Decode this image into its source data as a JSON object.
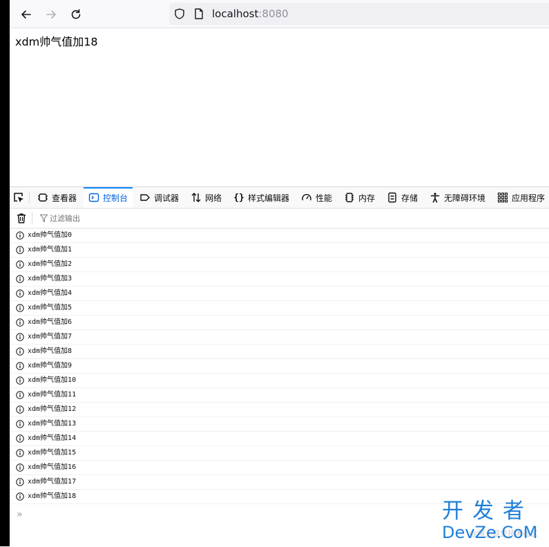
{
  "browser": {
    "url_host": "localhost",
    "url_port": ":8080"
  },
  "page": {
    "text": "xdm帅气值加18"
  },
  "devtools": {
    "tabs": [
      {
        "label": "查看器",
        "icon": "inspector-icon"
      },
      {
        "label": "控制台",
        "icon": "console-icon",
        "active": true
      },
      {
        "label": "调试器",
        "icon": "debugger-icon"
      },
      {
        "label": "网络",
        "icon": "network-icon"
      },
      {
        "label": "样式编辑器",
        "icon": "style-editor-icon"
      },
      {
        "label": "性能",
        "icon": "performance-icon"
      },
      {
        "label": "内存",
        "icon": "memory-icon"
      },
      {
        "label": "存储",
        "icon": "storage-icon"
      },
      {
        "label": "无障碍环境",
        "icon": "accessibility-icon"
      },
      {
        "label": "应用程序",
        "icon": "application-icon"
      }
    ],
    "filter_placeholder": "过滤输出",
    "logs": [
      "xdm帅气值加0",
      "xdm帅气值加1",
      "xdm帅气值加2",
      "xdm帅气值加3",
      "xdm帅气值加4",
      "xdm帅气值加5",
      "xdm帅气值加6",
      "xdm帅气值加7",
      "xdm帅气值加8",
      "xdm帅气值加9",
      "xdm帅气值加10",
      "xdm帅气值加11",
      "xdm帅气值加12",
      "xdm帅气值加13",
      "xdm帅气值加14",
      "xdm帅气值加15",
      "xdm帅气值加16",
      "xdm帅气值加17",
      "xdm帅气值加18"
    ],
    "prompt_symbol": "»"
  },
  "watermark": {
    "top": "开发者",
    "bottom": "DevZe.CoM",
    "faint": "@稀土掘金技术社区"
  },
  "colors": {
    "accent": "#0a84ff",
    "active_tab_text": "#0060df",
    "watermark": "#1f7fd9"
  }
}
